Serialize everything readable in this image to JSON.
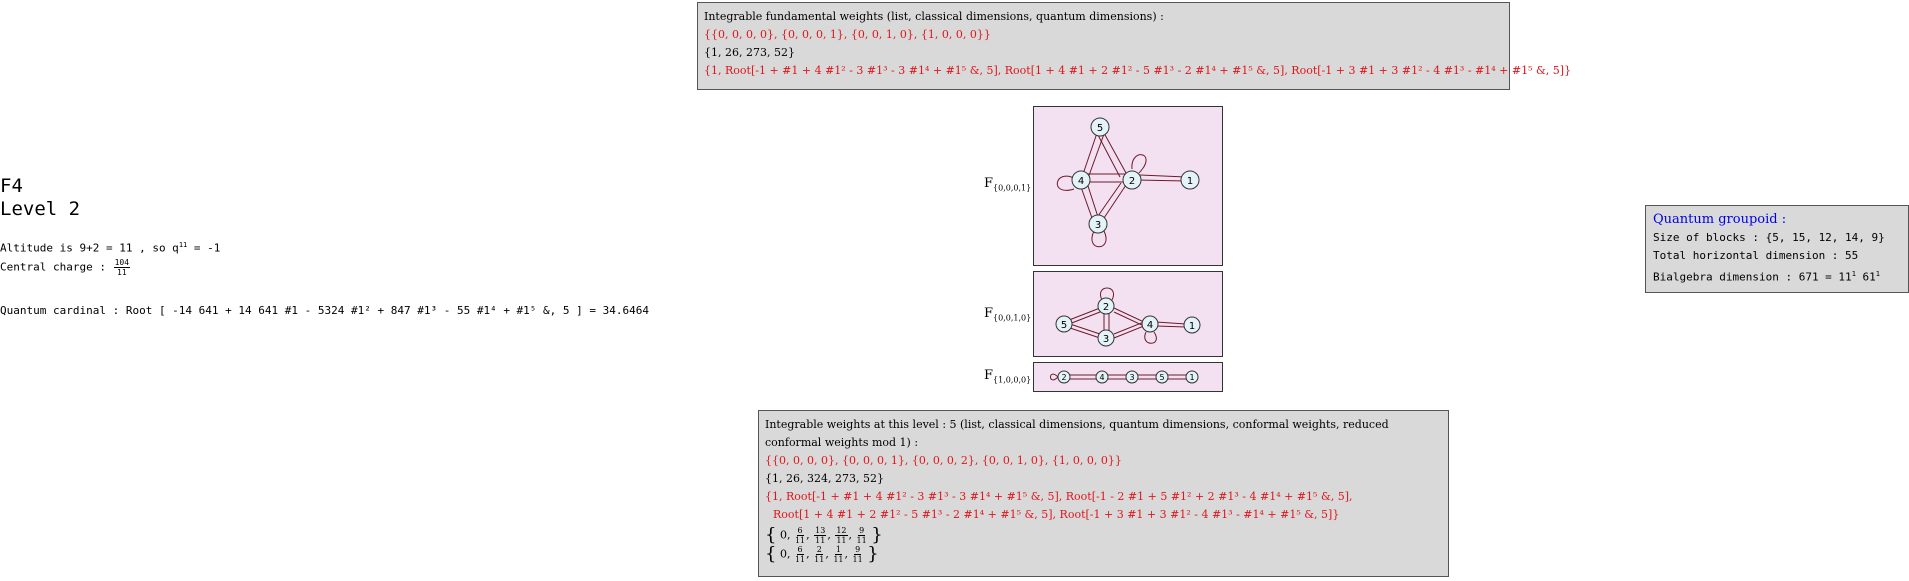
{
  "left": {
    "title1": "F4",
    "title2": "Level 2",
    "altitude": "Altitude is 9+2 = 11 , so q",
    "altitude_sup": "11",
    "altitude_end": " = -1",
    "central_charge_label": "Central charge :",
    "central_charge_num": "104",
    "central_charge_den": "11",
    "quantum_cardinal": "Quantum cardinal : Root [ -14 641 + 14 641 #1 - 5324 #1² + 847 #1³ - 55 #1⁴ + #1⁵ &, 5 ]  =  34.6464"
  },
  "top_box": {
    "header": "Integrable fundamental weights (list, classical dimensions, quantum dimensions) :",
    "weights": "{{0, 0, 0, 0}, {0, 0, 0, 1}, {0, 0, 1, 0}, {1, 0, 0, 0}}",
    "dims": "{1, 26, 273, 52}",
    "qdims": "{1, Root[-1 + #1 + 4 #1² - 3 #1³ - 3 #1⁴ + #1⁵ &, 5], Root[1 + 4 #1 + 2 #1² - 5 #1³ - 2 #1⁴ + #1⁵ &, 5], Root[-1 + 3 #1 + 3 #1² - 4 #1³ - #1⁴ + #1⁵ &, 5]}"
  },
  "graphs": {
    "g1": {
      "label": "F",
      "sub": "{0,0,0,1}",
      "nodes": [
        "5",
        "4",
        "2",
        "1",
        "3"
      ]
    },
    "g2": {
      "label": "F",
      "sub": "{0,0,1,0}",
      "nodes": [
        "2",
        "5",
        "4",
        "1",
        "3"
      ]
    },
    "g3": {
      "label": "F",
      "sub": "{1,0,0,0}",
      "nodes": [
        "2",
        "4",
        "3",
        "5",
        "1"
      ]
    }
  },
  "bottom_box": {
    "header": "Integrable weights at this level :  5 (list, classical dimensions, quantum dimensions, conformal weights, reduced conformal weights mod 1) :",
    "weights": "{{0, 0, 0, 0}, {0, 0, 0, 1}, {0, 0, 0, 2}, {0, 0, 1, 0}, {1, 0, 0, 0}}",
    "dims": "{1, 26, 324, 273, 52}",
    "qdims1": "{1, Root[-1 + #1 + 4 #1² - 3 #1³ - 3 #1⁴ + #1⁵ &, 5], Root[-1 - 2 #1 + 5 #1² + 2 #1³ - 4 #1⁴ + #1⁵ &, 5],",
    "qdims2": "Root[1 + 4 #1 + 2 #1² - 5 #1³ - 2 #1⁴ + #1⁵ &, 5], Root[-1 + 3 #1 + 3 #1² - 4 #1³ - #1⁴ + #1⁵ &, 5]}",
    "conf": {
      "open": "{",
      "first": "0,",
      "nums": [
        "6",
        "13",
        "12",
        "9"
      ],
      "den": "11",
      "close": "}"
    },
    "reduced": {
      "open": "{",
      "first": "0,",
      "nums": [
        "6",
        "2",
        "1",
        "9"
      ],
      "den": "11",
      "close": "}"
    }
  },
  "groupoid": {
    "title": "Quantum groupoid :",
    "blocks": "Size of blocks : {5, 15, 12, 14, 9}",
    "horizontal": "Total horizontal dimension : 55",
    "bialgebra": "Bialgebra dimension : 671 = 11",
    "bialgebra_sup1": "1",
    "bialgebra_mid": " 61",
    "bialgebra_sup2": "1"
  },
  "colors": {
    "box_bg": "#d9d9d9",
    "graph_bg": "#f3e1f1",
    "red": "#e0151b",
    "node_fill": "#e4f3f8",
    "blue": "#0000ee"
  }
}
